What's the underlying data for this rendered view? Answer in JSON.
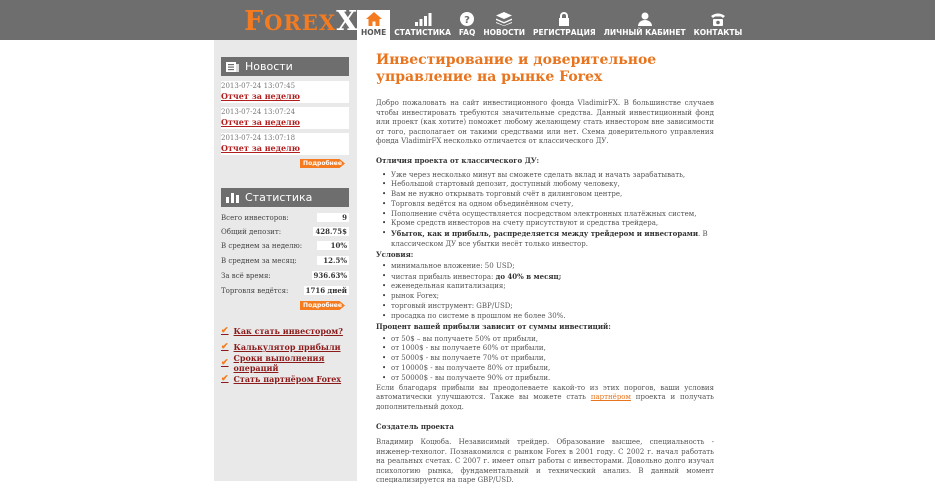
{
  "header": {
    "logo_big": "F",
    "logo_mid": "OREX",
    "nav": [
      {
        "label": "HOME",
        "icon": "home-icon"
      },
      {
        "label": "СТАТИСТИКА",
        "icon": "chart-icon"
      },
      {
        "label": "FAQ",
        "icon": "question-icon"
      },
      {
        "label": "НОВОСТИ",
        "icon": "stack-icon"
      },
      {
        "label": "РЕГИСТРАЦИЯ",
        "icon": "lock-icon"
      },
      {
        "label": "ЛИЧНЫЙ КАБИНЕТ",
        "icon": "user-icon"
      },
      {
        "label": "КОНТАКТЫ",
        "icon": "phone-icon"
      }
    ]
  },
  "sidebar": {
    "news_title": "Новости",
    "news": [
      {
        "date": "2013-07-24 13:07:45",
        "link": "Отчет за неделю"
      },
      {
        "date": "2013-07-24 13:07:24",
        "link": "Отчет за неделю"
      },
      {
        "date": "2013-07-24 13:07:18",
        "link": "Отчет за неделю"
      }
    ],
    "more_label": "Подробнее",
    "stats_title": "Статистика",
    "stats": [
      {
        "label": "Всего инвесторов:",
        "value": "9"
      },
      {
        "label": "Общий депозит:",
        "value": "428.75$"
      },
      {
        "label": "В среднем за неделю:",
        "value": "10%"
      },
      {
        "label": "В среднем за месяц:",
        "value": "12.5%"
      },
      {
        "label": "За всё время:",
        "value": "936.63%"
      },
      {
        "label": "Торговля ведётся:",
        "value": "1716 дней"
      }
    ],
    "links": [
      "Как стать инвестором?",
      "Калькулятор прибыли",
      "Сроки выполнения операций",
      "Стать партнёром Forex"
    ]
  },
  "content": {
    "title": "Инвестирование и доверительное управление на рынке Forex",
    "intro": "Добро пожаловать на сайт инвестиционного фонда VladimirFX. В большинстве случаев чтобы инвестировать требуются значительные средства. Данный инвестиционный фонд или проект (как хотите) поможет любому желающему стать инвестором вне зависимости от того, располагает он такими средствами или нет. Схема доверительного управления фонда VladimirFX несколько отличается от классического ДУ.",
    "diff_heading": "Отличия проекта от классического ДУ:",
    "diff_items": [
      "Уже через несколько минут вы сможете сделать вклад и начать зарабатывать,",
      "Небольшой стартовый депозит, доступный любому человеку,",
      "Вам не нужно открывать торговый счёт в дилинговом центре,",
      "Торговля ведётся на одном объединённом счету,",
      "Пополнение счёта осуществляется посредством электронных платёжных систем,",
      "Кроме средств инвесторов на счету присутствуют и средства трейдера,"
    ],
    "diff_last_bold": "Убыток, как и прибыль, распределяется между трейдером и инвесторами",
    "diff_last_rest": ". В классическом ДУ все убытки несёт только инвестор.",
    "cond_heading": "Условия:",
    "cond_items": [
      "минимальное вложение: 50 USD;",
      "чистая прибыль инвестора: ",
      "еженедельная капитализация;",
      "рынок Forex;",
      "торговый инструмент: GBP/USD;",
      "просадка по системе в прошлом не более 30%."
    ],
    "cond_bold": "до 40% в месяц;",
    "pct_heading": "Процент вашей прибыли зависит от суммы инвестиций:",
    "pct_items": [
      "от 50$ – вы получаете 50% от прибыли,",
      "от 1000$ - вы получаете 60% от прибыли,",
      "от 5000$ - вы получаете 70% от прибыли,",
      "от 10000$ - вы получаете 80% от прибыли,",
      "от 50000$ - вы получаете 90% от прибыли."
    ],
    "pct_after_1": "Если благодаря прибыли вы преодолеваете какой-то из этих порогов, ваши условия автоматически улучшаются. Также вы можете стать ",
    "pct_after_link": "партнёром",
    "pct_after_2": " проекта и получать дополнительный доход.",
    "creator_heading": "Создатель проекта",
    "creator_text": "Владимир Коцюба. Независимый трейдер. Образование высшее, специальность - инженер-технолог. Познакомился с рынком Forex в 2001 году. С 2002 г. начал работать на реальных счетах. С 2007 г. имеет опыт работы с инвесторами. Довольно долго изучал психологию рынка, фундаментальный и технический анализ. В данный момент специализируется на паре GBP/USD."
  }
}
